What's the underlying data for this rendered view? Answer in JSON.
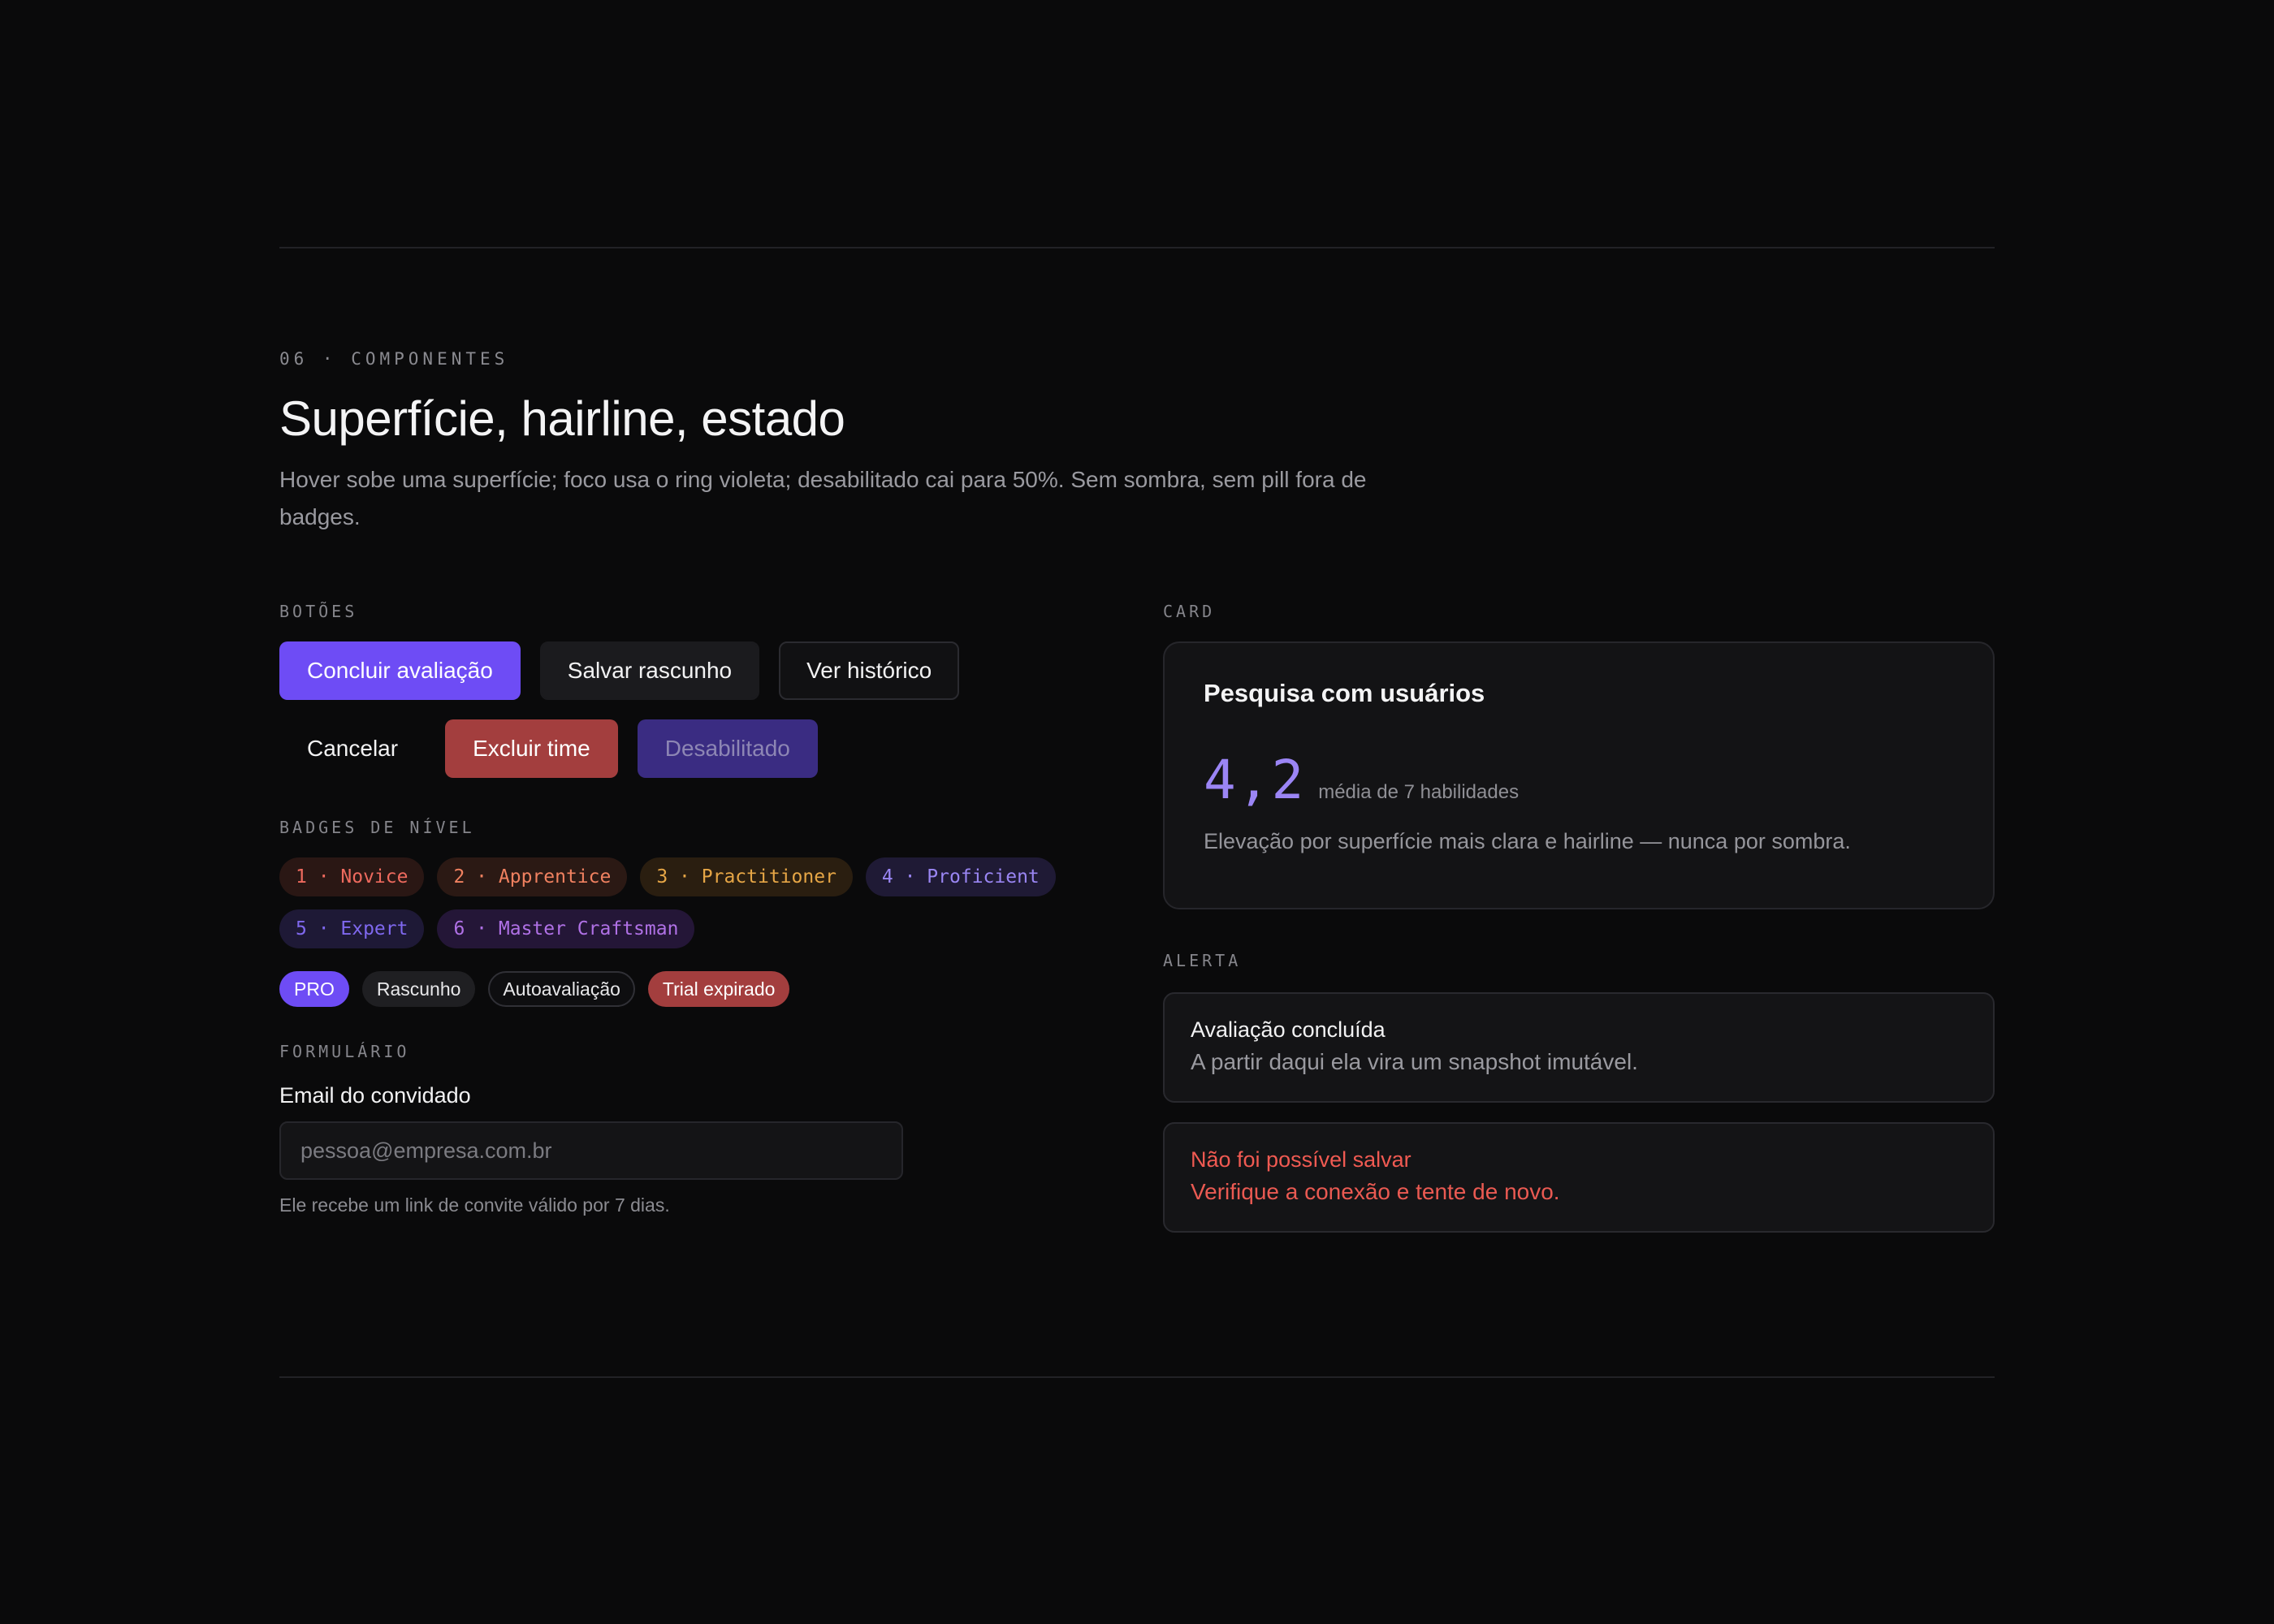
{
  "header": {
    "eyebrow": "06 · COMPONENTES",
    "title": "Superfície, hairline, estado",
    "subtitle": "Hover sobe uma superfície; foco usa o ring violeta; desabilitado cai para 50%. Sem sombra, sem pill fora de badges."
  },
  "buttons": {
    "section_label": "BOTÕES",
    "primary": "Concluir avaliação",
    "secondary": "Salvar rascunho",
    "outline": "Ver histórico",
    "ghost": "Cancelar",
    "danger": "Excluir time",
    "disabled": "Desabilitado"
  },
  "badges": {
    "section_label": "BADGES DE NÍVEL",
    "levels": [
      "1 · Novice",
      "2 · Apprentice",
      "3 · Practitioner",
      "4 · Proficient",
      "5 · Expert",
      "6 · Master Craftsman"
    ],
    "tags": [
      "PRO",
      "Rascunho",
      "Autoavaliação",
      "Trial expirado"
    ]
  },
  "form": {
    "section_label": "FORMULÁRIO",
    "label": "Email do convidado",
    "placeholder": "pessoa@empresa.com.br",
    "value": "",
    "help": "Ele recebe um link de convite válido por 7 dias."
  },
  "card": {
    "section_label": "CARD",
    "title": "Pesquisa com usuários",
    "metric": "4,2",
    "metric_caption": "média de 7 habilidades",
    "description": "Elevação por superfície mais clara e hairline — nunca por sombra."
  },
  "alerts": {
    "section_label": "ALERTA",
    "info": {
      "title": "Avaliação concluída",
      "body": "A partir daqui ela vira um snapshot imutável."
    },
    "error": {
      "title": "Não foi possível salvar",
      "body": "Verifique a conexão e tente de novo."
    }
  },
  "colors": {
    "background": "#0a0a0b",
    "accent": "#6e4cf5",
    "danger": "#a33e3e",
    "error_text": "#f05a52",
    "metric": "#9b85f5"
  }
}
